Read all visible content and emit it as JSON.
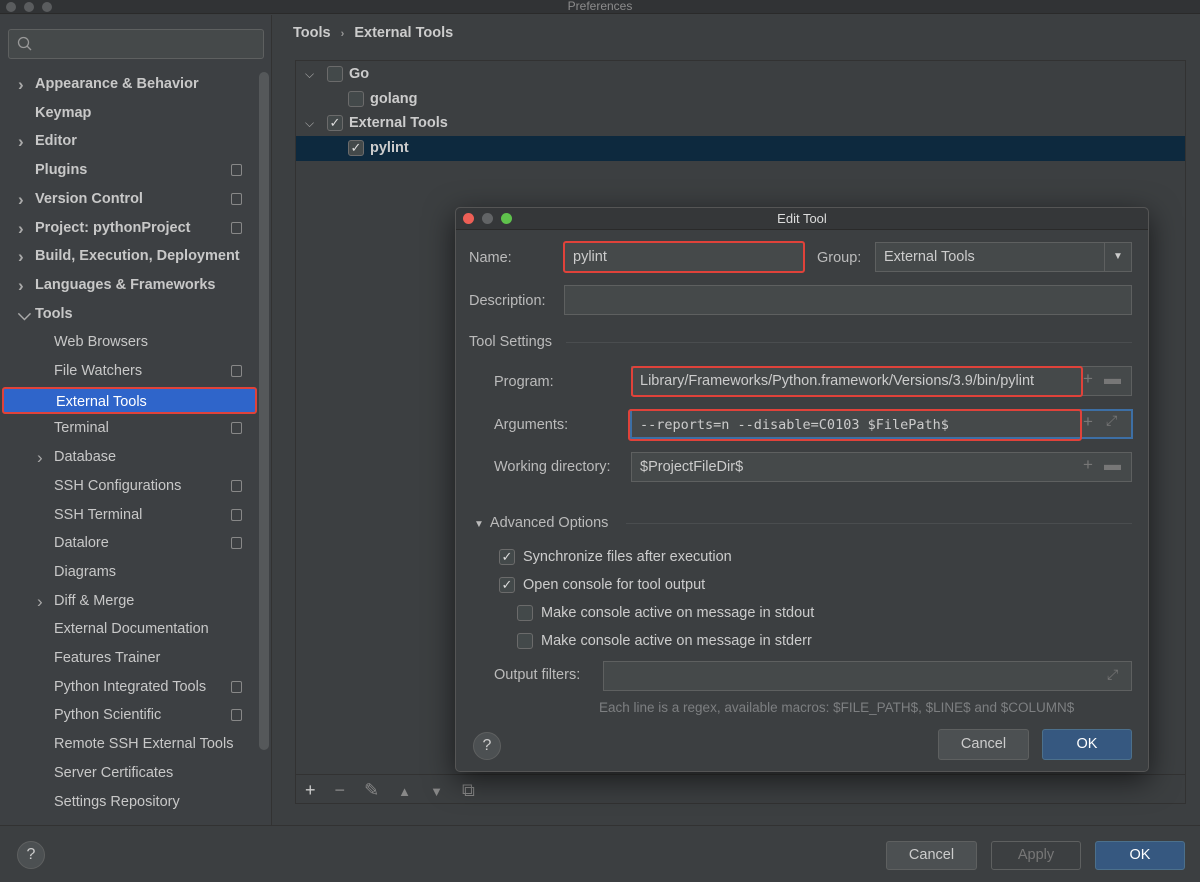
{
  "window": {
    "title": "Preferences"
  },
  "sidebar": {
    "search_placeholder": "",
    "items": [
      {
        "label": "Appearance & Behavior",
        "level": 0,
        "arrow": "›",
        "copy": false
      },
      {
        "label": "Keymap",
        "level": 0,
        "arrow": "",
        "copy": false
      },
      {
        "label": "Editor",
        "level": 0,
        "arrow": "›",
        "copy": false
      },
      {
        "label": "Plugins",
        "level": 0,
        "arrow": "",
        "copy": true
      },
      {
        "label": "Version Control",
        "level": 0,
        "arrow": "›",
        "copy": true
      },
      {
        "label": "Project: pythonProject",
        "level": 0,
        "arrow": "›",
        "copy": true
      },
      {
        "label": "Build, Execution, Deployment",
        "level": 0,
        "arrow": "›",
        "copy": false
      },
      {
        "label": "Languages & Frameworks",
        "level": 0,
        "arrow": "›",
        "copy": false
      },
      {
        "label": "Tools",
        "level": 0,
        "arrow": "⌄",
        "copy": false
      },
      {
        "label": "Web Browsers",
        "level": 1,
        "arrow": "",
        "copy": false
      },
      {
        "label": "File Watchers",
        "level": 1,
        "arrow": "",
        "copy": true
      },
      {
        "label": "External Tools",
        "level": 1,
        "arrow": "",
        "copy": false,
        "selected": true
      },
      {
        "label": "Terminal",
        "level": 1,
        "arrow": "",
        "copy": true
      },
      {
        "label": "Database",
        "level": 1,
        "arrow": "›",
        "copy": false
      },
      {
        "label": "SSH Configurations",
        "level": 1,
        "arrow": "",
        "copy": true
      },
      {
        "label": "SSH Terminal",
        "level": 1,
        "arrow": "",
        "copy": true
      },
      {
        "label": "Datalore",
        "level": 1,
        "arrow": "",
        "copy": true
      },
      {
        "label": "Diagrams",
        "level": 1,
        "arrow": "",
        "copy": false
      },
      {
        "label": "Diff & Merge",
        "level": 1,
        "arrow": "›",
        "copy": false
      },
      {
        "label": "External Documentation",
        "level": 1,
        "arrow": "",
        "copy": false
      },
      {
        "label": "Features Trainer",
        "level": 1,
        "arrow": "",
        "copy": false
      },
      {
        "label": "Python Integrated Tools",
        "level": 1,
        "arrow": "",
        "copy": true
      },
      {
        "label": "Python Scientific",
        "level": 1,
        "arrow": "",
        "copy": true
      },
      {
        "label": "Remote SSH External Tools",
        "level": 1,
        "arrow": "",
        "copy": false
      },
      {
        "label": "Server Certificates",
        "level": 1,
        "arrow": "",
        "copy": false
      },
      {
        "label": "Settings Repository",
        "level": 1,
        "arrow": "",
        "copy": false
      }
    ]
  },
  "breadcrumb": {
    "parent": "Tools",
    "separator": "›",
    "current": "External Tools"
  },
  "tree": [
    {
      "label": "Go",
      "level": 0,
      "expanded": true,
      "checked": false
    },
    {
      "label": "golang",
      "level": 1,
      "checked": false
    },
    {
      "label": "External Tools",
      "level": 0,
      "expanded": true,
      "checked": true
    },
    {
      "label": "pylint",
      "level": 1,
      "checked": true,
      "selected": true
    }
  ],
  "tree_toolbar": {
    "add": "+",
    "remove": "−",
    "edit": "✎",
    "up": "▲",
    "down": "▼",
    "copy": "⧉"
  },
  "dialog": {
    "title": "Edit Tool",
    "name_label": "Name:",
    "name_value": "pylint",
    "group_label": "Group:",
    "group_value": "External Tools",
    "description_label": "Description:",
    "description_value": "",
    "tool_settings": "Tool Settings",
    "program_label": "Program:",
    "program_value": "Library/Frameworks/Python.framework/Versions/3.9/bin/pylint",
    "arguments_label": "Arguments:",
    "arguments_value": "--reports=n --disable=C0103 $FilePath$",
    "workdir_label": "Working directory:",
    "workdir_value": "$ProjectFileDir$",
    "advanced": "Advanced Options",
    "options": [
      {
        "label": "Synchronize files after execution",
        "checked": true
      },
      {
        "label": "Open console for tool output",
        "checked": true
      },
      {
        "label": "Make console active on message in stdout",
        "checked": false
      },
      {
        "label": "Make console active on message in stderr",
        "checked": false
      }
    ],
    "output_filters_label": "Output filters:",
    "output_filters_value": "",
    "hint": "Each line is a regex, available macros: $FILE_PATH$, $LINE$ and $COLUMN$",
    "cancel": "Cancel",
    "ok": "OK",
    "help": "?"
  },
  "footer": {
    "help": "?",
    "cancel": "Cancel",
    "apply": "Apply",
    "ok": "OK"
  },
  "colors": {
    "accent": "#2f65ca",
    "highlight": "#e0423a",
    "ok_button": "#365880",
    "tree_selection": "#0d293e"
  }
}
